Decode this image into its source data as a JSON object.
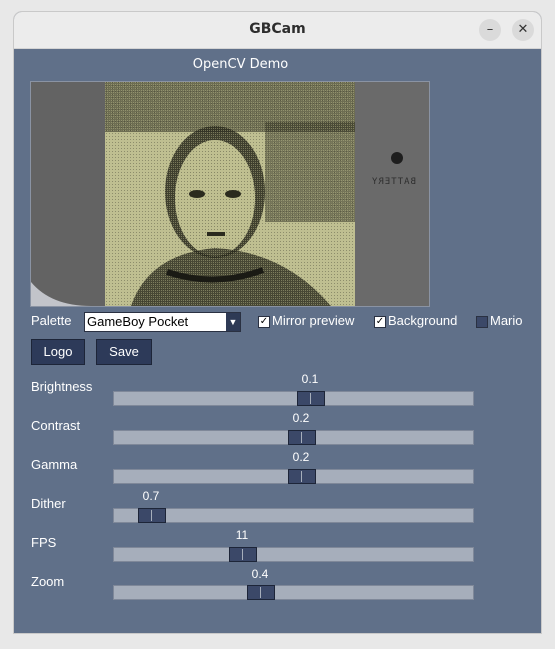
{
  "window": {
    "title": "GBCam"
  },
  "subtitle": "OpenCV Demo",
  "preview": {
    "battery_label": "BATTERY"
  },
  "controls": {
    "palette_label": "Palette",
    "palette_value": "GameBoy Pocket",
    "mirror_label": "Mirror preview",
    "mirror_checked": true,
    "background_label": "Background",
    "background_checked": true,
    "mario_label": "Mario",
    "mario_checked": false,
    "logo_button": "Logo",
    "save_button": "Save"
  },
  "sliders": [
    {
      "label": "Brightness",
      "value": "0.1",
      "position": 0.55
    },
    {
      "label": "Contrast",
      "value": "0.2",
      "position": 0.525
    },
    {
      "label": "Gamma",
      "value": "0.2",
      "position": 0.525
    },
    {
      "label": "Dither",
      "value": "0.7",
      "position": 0.1
    },
    {
      "label": "FPS",
      "value": "11",
      "position": 0.36
    },
    {
      "label": "Zoom",
      "value": "0.4",
      "position": 0.41
    }
  ],
  "colors": {
    "window_bg": "#607089",
    "preview_green": "#c7c79a",
    "button_bg": "#2d3a59"
  }
}
